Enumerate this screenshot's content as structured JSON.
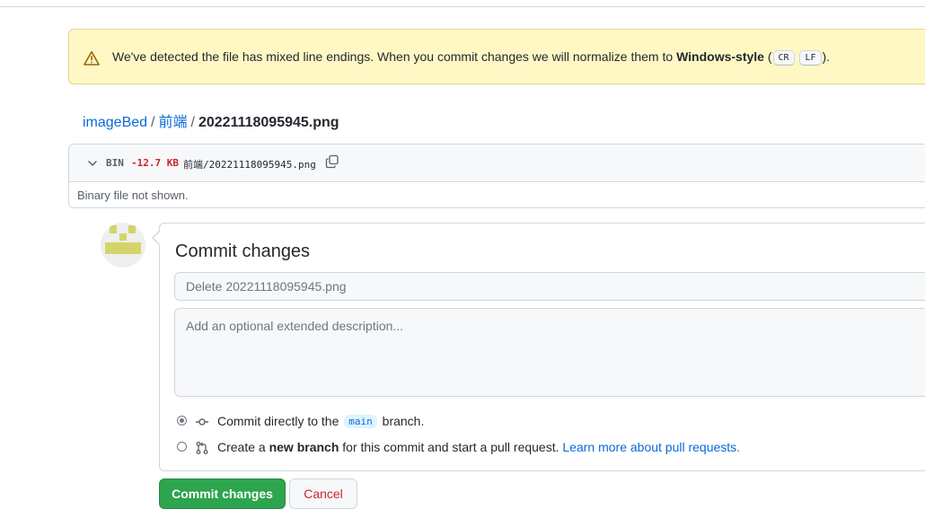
{
  "flash": {
    "icon": "alert-icon",
    "text_before": "We've detected the file has mixed line endings. When you commit changes we will normalize them to ",
    "style_name": "Windows-style",
    "text_paren_open": " (",
    "kbd_cr": "CR",
    "kbd_lf": "LF",
    "text_end": ")."
  },
  "breadcrumb": {
    "repo": "imageBed",
    "separator": "/",
    "folder": "前端",
    "file": "20221118095945.png"
  },
  "file": {
    "badge": "BIN",
    "size_change": "-12.7 KB",
    "path": "前端/20221118095945.png",
    "body_text": "Binary file not shown."
  },
  "commit": {
    "title": "Commit changes",
    "summary_placeholder": "Delete 20221118095945.png",
    "description_placeholder": "Add an optional extended description...",
    "option_direct": {
      "text_before": "Commit directly to the",
      "branch": "main",
      "text_after": "branch.",
      "selected": true
    },
    "option_new_branch": {
      "text_before": "Create a ",
      "bold": "new branch",
      "text_after": " for this commit and start a pull request. ",
      "link": "Learn more about pull requests.",
      "selected": false
    },
    "commit_button": "Commit changes",
    "cancel_button": "Cancel"
  },
  "colors": {
    "flash_bg": "#fff8c5",
    "link": "#0969da",
    "danger": "#cf222e",
    "primary_button": "#2da44e",
    "avatar_identicon": "#d4d46a"
  }
}
